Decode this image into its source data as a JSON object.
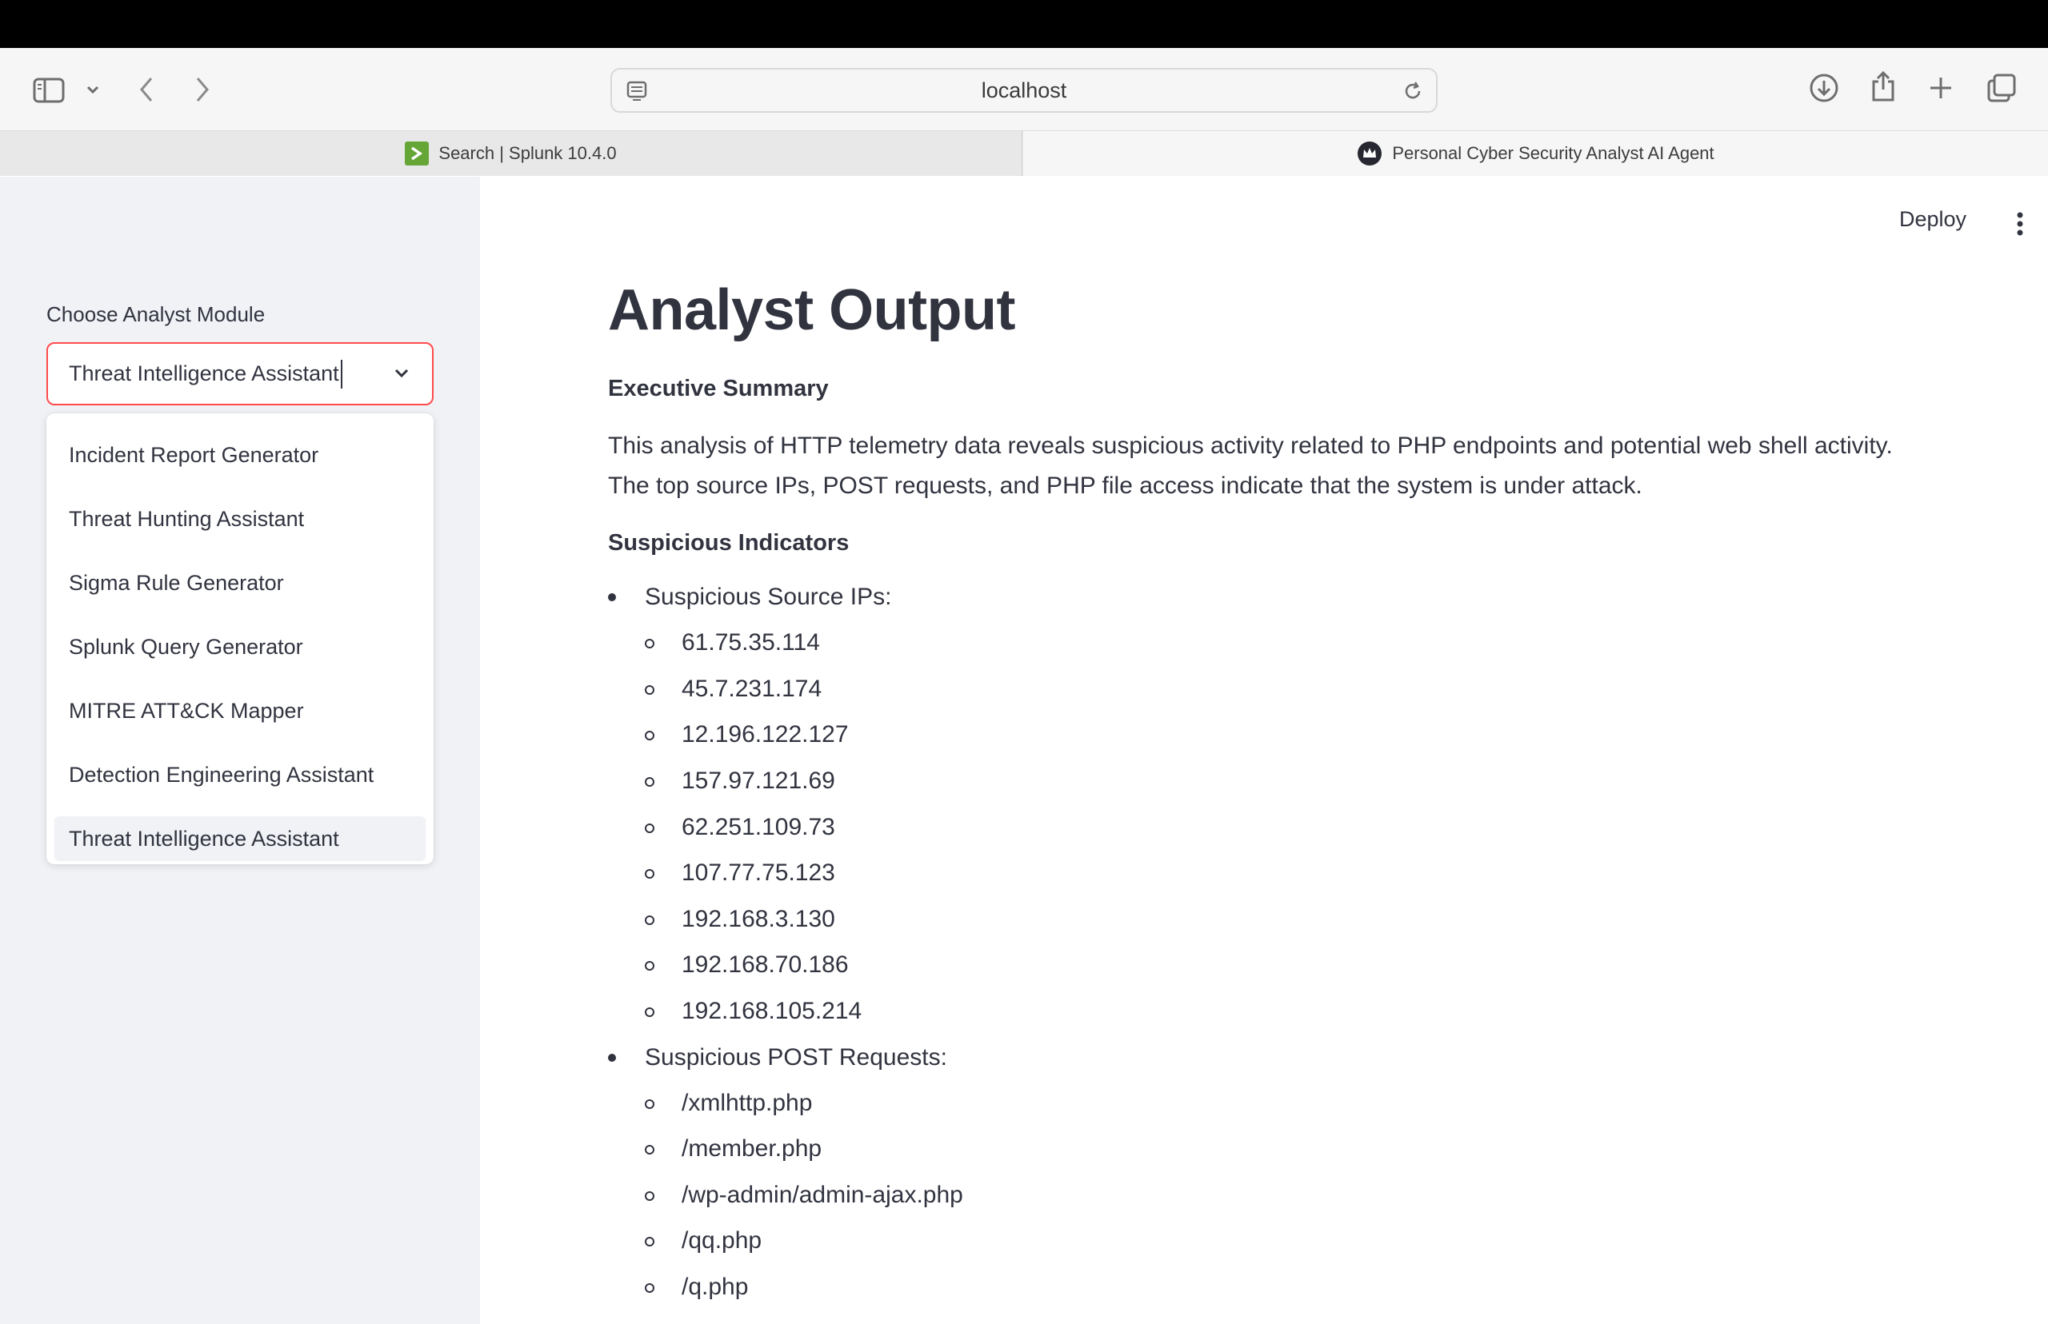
{
  "browser": {
    "url": "localhost",
    "tabs": [
      {
        "label": "Search | Splunk 10.4.0",
        "active": false
      },
      {
        "label": "Personal Cyber Security Analyst AI Agent",
        "active": true
      }
    ],
    "icons": [
      "sidebar-icon",
      "chevron-down-icon",
      "back-icon",
      "forward-icon",
      "page-icon",
      "reload-icon",
      "download-icon",
      "share-icon",
      "plus-icon",
      "tabs-overview-icon"
    ]
  },
  "sidebar": {
    "label": "Choose Analyst Module",
    "selected": "Threat Intelligence Assistant",
    "options": [
      "Incident Report Generator",
      "Threat Hunting Assistant",
      "Sigma Rule Generator",
      "Splunk Query Generator",
      "MITRE ATT&CK Mapper",
      "Detection Engineering Assistant",
      "Threat Intelligence Assistant"
    ]
  },
  "header": {
    "deploy": "Deploy"
  },
  "main": {
    "title": "Analyst Output",
    "executive_summary_heading": "Executive Summary",
    "executive_summary_line1": "This analysis of HTTP telemetry data reveals suspicious activity related to PHP endpoints and potential web shell activity.",
    "executive_summary_line2": "The top source IPs, POST requests, and PHP file access indicate that the system is under attack.",
    "indicators_heading": "Suspicious Indicators",
    "source_ips_label": "Suspicious Source IPs:",
    "source_ips": [
      "61.75.35.114",
      "45.7.231.174",
      "12.196.122.127",
      "157.97.121.69",
      "62.251.109.73",
      "107.77.75.123",
      "192.168.3.130",
      "192.168.70.186",
      "192.168.105.214"
    ],
    "post_requests_label": "Suspicious POST Requests:",
    "post_requests": [
      "/xmlhttp.php",
      "/member.php",
      "/wp-admin/admin-ajax.php",
      "/qq.php",
      "/q.php"
    ]
  },
  "colors": {
    "sidebar_bg": "#f0f2f6",
    "accent": "#ff4b4b",
    "text": "#31333f",
    "splunk_green": "#65a637"
  }
}
